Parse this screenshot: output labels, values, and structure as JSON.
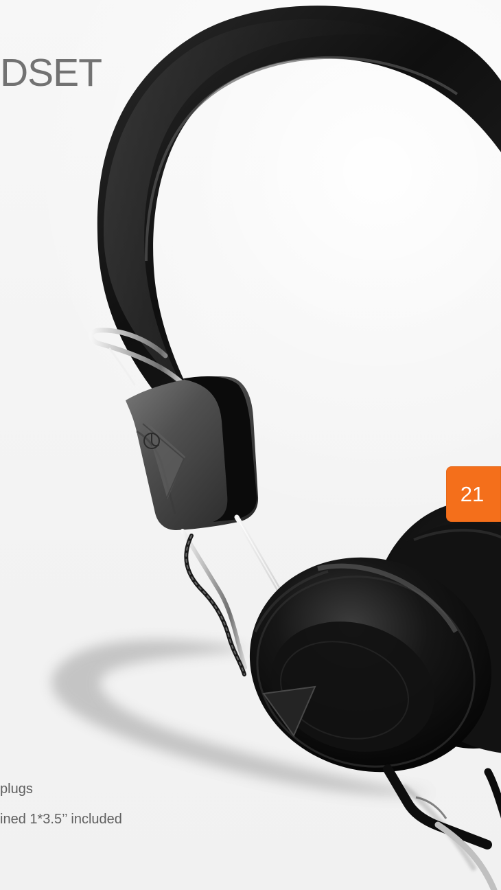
{
  "page": {
    "title": "DSET",
    "page_number": "21",
    "features": [
      "plugs",
      "ined 1*3.5’’ included"
    ]
  },
  "colors": {
    "background": "#f3f3f3",
    "title": "#727272",
    "badge": "#f46f1b",
    "headset": "#111111",
    "metal": "#c9c9c9"
  },
  "image": {
    "subject": "headset-icon"
  }
}
